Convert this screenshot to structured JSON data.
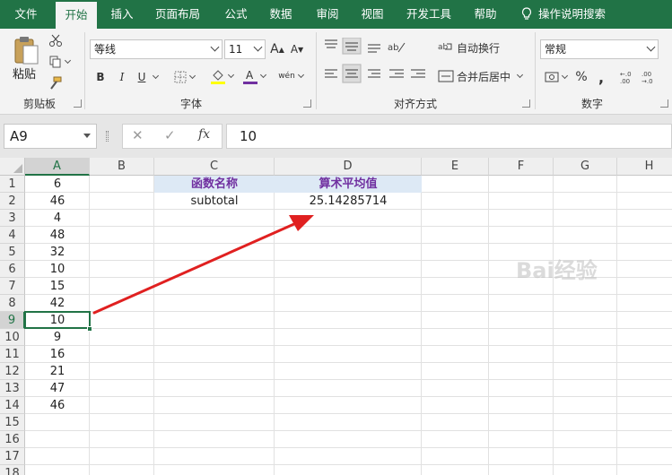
{
  "ribbon_tabs": [
    "文件",
    "开始",
    "插入",
    "页面布局",
    "公式",
    "数据",
    "审阅",
    "视图",
    "开发工具",
    "帮助"
  ],
  "active_tab": "开始",
  "tell_me": "操作说明搜索",
  "clipboard": {
    "paste_label": "粘贴",
    "group_label": "剪贴板"
  },
  "font": {
    "name": "等线",
    "size": "11",
    "group_label": "字体",
    "bold": "B",
    "italic": "I",
    "underline": "U",
    "phonetic": "wén"
  },
  "alignment": {
    "wrap_text": "自动换行",
    "merge_center": "合并后居中",
    "group_label": "对齐方式"
  },
  "number": {
    "format": "常规",
    "percent": "%",
    "comma": ",",
    "group_label": "数字"
  },
  "formula_bar": {
    "name_box": "A9",
    "fx": "fx",
    "content": "10"
  },
  "columns": [
    "A",
    "B",
    "C",
    "D",
    "E",
    "F",
    "G",
    "H"
  ],
  "selected_column": "A",
  "rows": [
    "1",
    "2",
    "3",
    "4",
    "5",
    "6",
    "7",
    "8",
    "9",
    "10",
    "11",
    "12",
    "13",
    "14",
    "15",
    "16",
    "17",
    "18"
  ],
  "selected_row": "9",
  "column_a_values": [
    "6",
    "46",
    "4",
    "48",
    "32",
    "10",
    "15",
    "42",
    "10",
    "9",
    "16",
    "21",
    "47",
    "46"
  ],
  "table": {
    "header_c": "函数名称",
    "header_d": "算术平均值",
    "value_c": "subtotal",
    "value_d": "25.14285714"
  },
  "colors": {
    "excel_green": "#217346",
    "header_fill": "#dde9f5",
    "header_text": "#7030a0",
    "arrow": "#e02020"
  },
  "watermark": "Bai经验"
}
